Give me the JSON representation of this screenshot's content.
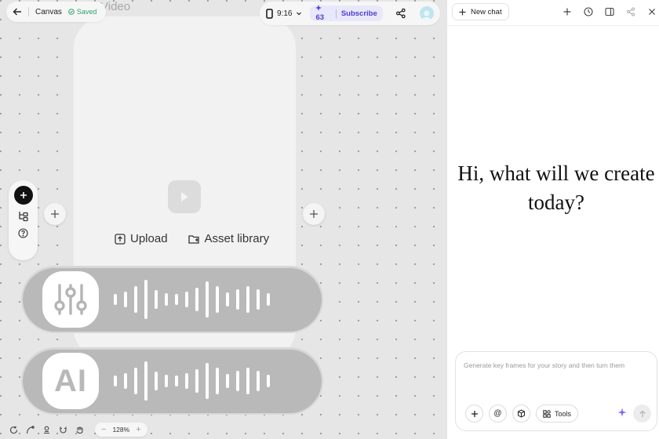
{
  "canvas": {
    "frame_title": "Video",
    "upload_label": "Upload",
    "asset_library_label": "Asset library",
    "zoom_level": "128%"
  },
  "top_left": {
    "canvas_label": "Canvas",
    "saved_label": "Saved"
  },
  "top_right": {
    "aspect_ratio": "9:16",
    "credits": "63",
    "subscribe_label": "Subscribe"
  },
  "overlays": {
    "ai_badge": "AI"
  },
  "chat": {
    "new_chat_label": "New chat",
    "greeting_line1": "Hi, what will we create",
    "greeting_line2": "today?",
    "input_placeholder": "Generate key frames for your story and then turn them",
    "tools_label": "Tools"
  },
  "icons": {
    "back": "arrow-left-icon",
    "saved": "check-circle-icon",
    "ratio": "phone-portrait-icon",
    "credits": "sparkle-icon",
    "share": "share-icon",
    "avatar": "user-avatar-icon",
    "add": "plus-icon",
    "help": "question-icon",
    "history": "clock-icon",
    "window": "window-icon",
    "close": "close-icon"
  },
  "colors": {
    "accent": "#4a3fd1",
    "saved_green": "#2fa36b",
    "canvas_bg": "#e6e6e6"
  }
}
